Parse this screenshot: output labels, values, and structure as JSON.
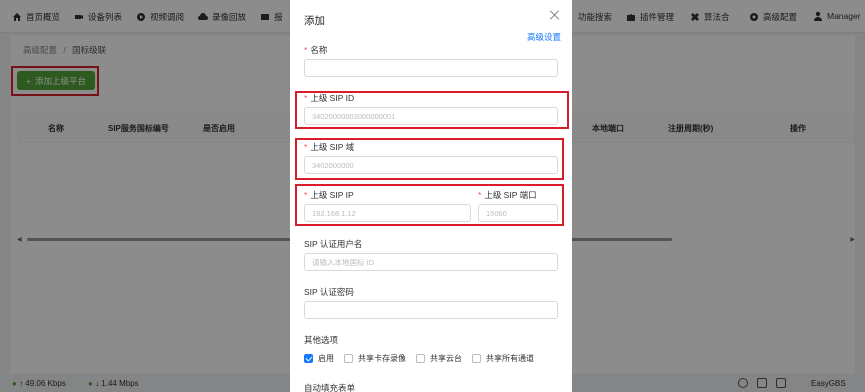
{
  "topnav": {
    "left_items": [
      {
        "label": "首页概览",
        "icon": "home-icon"
      },
      {
        "label": "设备列表",
        "icon": "camera-icon"
      },
      {
        "label": "视频调阅",
        "icon": "play-icon"
      },
      {
        "label": "录像回放",
        "icon": "cloud-icon"
      },
      {
        "label": "报",
        "icon": "list-icon"
      }
    ],
    "right_items": [
      {
        "label": "功能搜索"
      },
      {
        "label": "插件管理",
        "icon": "puzzle-icon"
      },
      {
        "label": "算法合",
        "icon": "dropbox-icon"
      },
      {
        "label": "高级配置",
        "icon": "gear-icon"
      },
      {
        "label": "Manager",
        "icon": "user-icon"
      }
    ]
  },
  "breadcrumb": {
    "parent": "高级配置",
    "separator": "/",
    "current": "国标级联"
  },
  "add_button": {
    "icon": "+",
    "label": "添加上级平台"
  },
  "table": {
    "headers": [
      "名称",
      "SIP服务国标编号",
      "是否启用",
      "本地端口",
      "注册周期(秒)",
      "操作"
    ]
  },
  "status": {
    "upload": "↑ 49.06 Kbps",
    "download": "↓ 1.44 Mbps",
    "brand": "EasyGBS"
  },
  "modal": {
    "title": "添加",
    "advanced_link": "高级设置",
    "name": {
      "label": "名称",
      "value": "",
      "placeholder": ""
    },
    "sip_id": {
      "label": "上级 SIP ID",
      "placeholder": "34020000002000000001"
    },
    "sip_domain": {
      "label": "上级 SIP 域",
      "placeholder": "3402000000"
    },
    "sip_ip": {
      "label": "上级 SIP IP",
      "placeholder": "192.168.1.12"
    },
    "sip_port": {
      "label": "上级 SIP 端口",
      "placeholder": "15060"
    },
    "auth_user": {
      "label": "SIP 认证用户名",
      "placeholder": "请输入本地国标 ID"
    },
    "auth_password": {
      "label": "SIP 认证密码",
      "placeholder": ""
    },
    "other_options": {
      "label": "其他选项",
      "options": [
        {
          "label": "启用",
          "checked": true
        },
        {
          "label": "共享卡存录像",
          "checked": false
        },
        {
          "label": "共享云台",
          "checked": false
        },
        {
          "label": "共享所有通道",
          "checked": false
        }
      ]
    },
    "autofill_label": "自动填充表单"
  },
  "colors": {
    "accent": "#1677ff",
    "add_button": "#52a43a",
    "highlight": "#d91e2b",
    "required": "#ff4d4f"
  }
}
